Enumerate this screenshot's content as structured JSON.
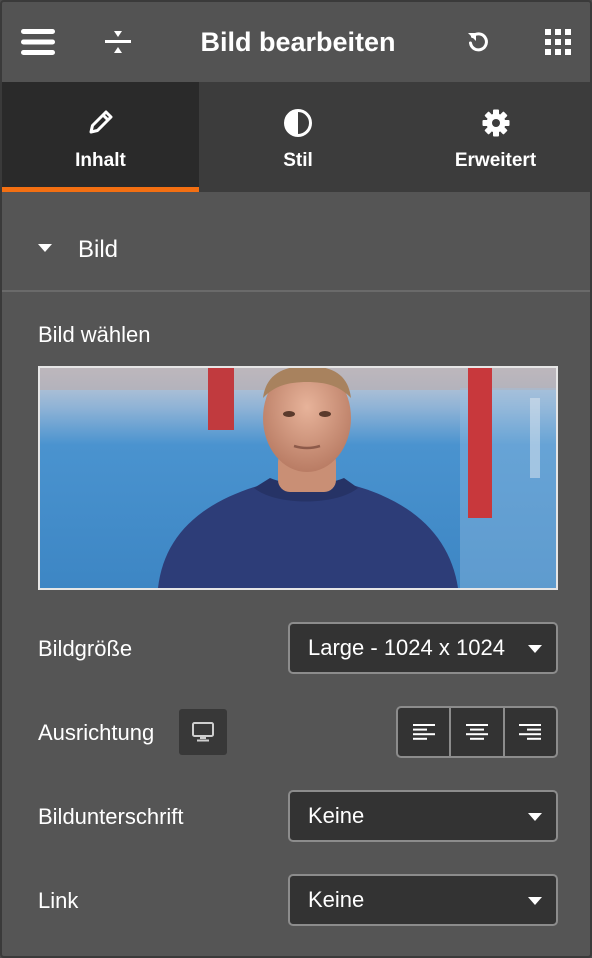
{
  "header": {
    "title": "Bild bearbeiten",
    "icons": [
      "hamburger-menu-icon",
      "expand-collapse-icon",
      "undo-icon",
      "grid-apps-icon"
    ]
  },
  "tabs": [
    {
      "label": "Inhalt",
      "icon": "pencil-icon",
      "active": true
    },
    {
      "label": "Stil",
      "icon": "half-circle-contrast-icon",
      "active": false
    },
    {
      "label": "Erweitert",
      "icon": "gear-icon",
      "active": false
    }
  ],
  "section": {
    "title": "Bild",
    "expanded": true
  },
  "fields": {
    "image_label": "Bild wählen",
    "size_label": "Bildgröße",
    "size_value": "Large - 1024 x 1024",
    "alignment_label": "Ausrichtung",
    "caption_label": "Bildunterschrift",
    "caption_value": "Keine",
    "link_label": "Link",
    "link_value": "Keine"
  },
  "colors": {
    "accent": "#f36f12",
    "panel_bg": "#555555",
    "tab_bar_bg": "#3c3c3c",
    "active_tab_bg": "#2a2a2a",
    "input_bg": "#333333"
  }
}
